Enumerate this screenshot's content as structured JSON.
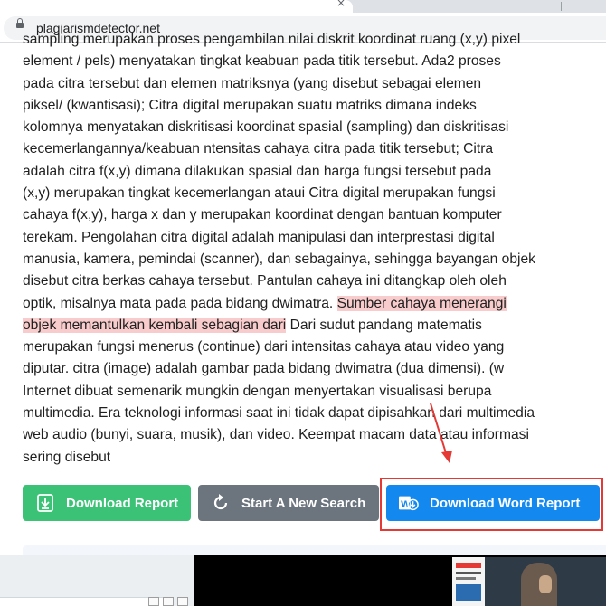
{
  "browser": {
    "url": "plagiarismdetector.net"
  },
  "article": {
    "lines": [
      "sampling merupakan proses pengambilan nilai diskrit koordinat ruang (x,y) pixel",
      "element / pels) menyatakan tingkat keabuan pada titik tersebut. Ada2 proses",
      "pada citra tersebut dan elemen matriksnya (yang disebut sebagai elemen",
      "piksel/ (kwantisasi); Citra digital merupakan suatu matriks dimana indeks",
      "kolomnya menyatakan diskritisasi koordinat spasial (sampling) dan diskritisasi",
      "kecemerlangannya/keabuan ntensitas cahaya citra pada titik tersebut; Citra",
      "adalah citra f(x,y) dimana dilakukan spasial dan harga fungsi tersebut pada",
      "(x,y) merupakan tingkat kecemerlangan ataui Citra digital merupakan fungsi",
      "cahaya f(x,y), harga x dan y merupakan koordinat dengan bantuan komputer",
      "terekam. Pengolahan citra digital adalah manipulasi dan interprestasi digital",
      "manusia, kamera, pemindai (scanner), dan sebagainya, sehingga bayangan objek",
      "disebut citra berkas cahaya tersebut. Pantulan cahaya ini ditangkap oleh oleh"
    ],
    "line13_plain": "optik, misalnya mata pada pada bidang dwimatra. ",
    "line13_highlight": "Sumber cahaya menerangi",
    "line14_highlight": "objek memantulkan kembali sebagian dari",
    "line14_plain": " Dari sudut pandang matematis",
    "lines_after": [
      "merupakan fungsi menerus (continue) dari intensitas cahaya atau video yang",
      "diputar. citra (image) adalah gambar pada bidang dwimatra (dua dimensi). (w",
      "Internet dibuat semenarik mungkin dengan menyertakan visualisasi berupa",
      "multimedia. Era teknologi informasi saat ini tidak dapat dipisahkan dari multimedia",
      "web audio (bunyi, suara, musik), dan video. Keempat macam data atau informasi",
      "sering disebut"
    ]
  },
  "buttons": {
    "download_report": "Download Report",
    "new_search": "Start A New Search",
    "download_word": "Download Word Report"
  },
  "colors": {
    "highlight": "#f8cccc",
    "green": "#3cc276",
    "gray": "#6c757d",
    "blue": "#1389f0",
    "annotation_red": "#e53935"
  }
}
